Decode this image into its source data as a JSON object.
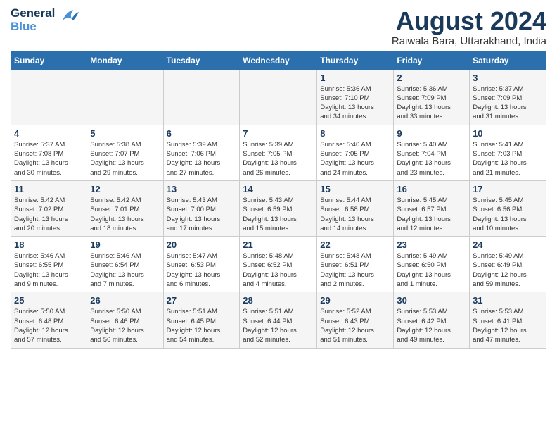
{
  "header": {
    "logo_line1": "General",
    "logo_line2": "Blue",
    "month_title": "August 2024",
    "location": "Raiwala Bara, Uttarakhand, India"
  },
  "days_of_week": [
    "Sunday",
    "Monday",
    "Tuesday",
    "Wednesday",
    "Thursday",
    "Friday",
    "Saturday"
  ],
  "weeks": [
    [
      {
        "day": "",
        "info": ""
      },
      {
        "day": "",
        "info": ""
      },
      {
        "day": "",
        "info": ""
      },
      {
        "day": "",
        "info": ""
      },
      {
        "day": "1",
        "info": "Sunrise: 5:36 AM\nSunset: 7:10 PM\nDaylight: 13 hours\nand 34 minutes."
      },
      {
        "day": "2",
        "info": "Sunrise: 5:36 AM\nSunset: 7:09 PM\nDaylight: 13 hours\nand 33 minutes."
      },
      {
        "day": "3",
        "info": "Sunrise: 5:37 AM\nSunset: 7:09 PM\nDaylight: 13 hours\nand 31 minutes."
      }
    ],
    [
      {
        "day": "4",
        "info": "Sunrise: 5:37 AM\nSunset: 7:08 PM\nDaylight: 13 hours\nand 30 minutes."
      },
      {
        "day": "5",
        "info": "Sunrise: 5:38 AM\nSunset: 7:07 PM\nDaylight: 13 hours\nand 29 minutes."
      },
      {
        "day": "6",
        "info": "Sunrise: 5:39 AM\nSunset: 7:06 PM\nDaylight: 13 hours\nand 27 minutes."
      },
      {
        "day": "7",
        "info": "Sunrise: 5:39 AM\nSunset: 7:05 PM\nDaylight: 13 hours\nand 26 minutes."
      },
      {
        "day": "8",
        "info": "Sunrise: 5:40 AM\nSunset: 7:05 PM\nDaylight: 13 hours\nand 24 minutes."
      },
      {
        "day": "9",
        "info": "Sunrise: 5:40 AM\nSunset: 7:04 PM\nDaylight: 13 hours\nand 23 minutes."
      },
      {
        "day": "10",
        "info": "Sunrise: 5:41 AM\nSunset: 7:03 PM\nDaylight: 13 hours\nand 21 minutes."
      }
    ],
    [
      {
        "day": "11",
        "info": "Sunrise: 5:42 AM\nSunset: 7:02 PM\nDaylight: 13 hours\nand 20 minutes."
      },
      {
        "day": "12",
        "info": "Sunrise: 5:42 AM\nSunset: 7:01 PM\nDaylight: 13 hours\nand 18 minutes."
      },
      {
        "day": "13",
        "info": "Sunrise: 5:43 AM\nSunset: 7:00 PM\nDaylight: 13 hours\nand 17 minutes."
      },
      {
        "day": "14",
        "info": "Sunrise: 5:43 AM\nSunset: 6:59 PM\nDaylight: 13 hours\nand 15 minutes."
      },
      {
        "day": "15",
        "info": "Sunrise: 5:44 AM\nSunset: 6:58 PM\nDaylight: 13 hours\nand 14 minutes."
      },
      {
        "day": "16",
        "info": "Sunrise: 5:45 AM\nSunset: 6:57 PM\nDaylight: 13 hours\nand 12 minutes."
      },
      {
        "day": "17",
        "info": "Sunrise: 5:45 AM\nSunset: 6:56 PM\nDaylight: 13 hours\nand 10 minutes."
      }
    ],
    [
      {
        "day": "18",
        "info": "Sunrise: 5:46 AM\nSunset: 6:55 PM\nDaylight: 13 hours\nand 9 minutes."
      },
      {
        "day": "19",
        "info": "Sunrise: 5:46 AM\nSunset: 6:54 PM\nDaylight: 13 hours\nand 7 minutes."
      },
      {
        "day": "20",
        "info": "Sunrise: 5:47 AM\nSunset: 6:53 PM\nDaylight: 13 hours\nand 6 minutes."
      },
      {
        "day": "21",
        "info": "Sunrise: 5:48 AM\nSunset: 6:52 PM\nDaylight: 13 hours\nand 4 minutes."
      },
      {
        "day": "22",
        "info": "Sunrise: 5:48 AM\nSunset: 6:51 PM\nDaylight: 13 hours\nand 2 minutes."
      },
      {
        "day": "23",
        "info": "Sunrise: 5:49 AM\nSunset: 6:50 PM\nDaylight: 13 hours\nand 1 minute."
      },
      {
        "day": "24",
        "info": "Sunrise: 5:49 AM\nSunset: 6:49 PM\nDaylight: 12 hours\nand 59 minutes."
      }
    ],
    [
      {
        "day": "25",
        "info": "Sunrise: 5:50 AM\nSunset: 6:48 PM\nDaylight: 12 hours\nand 57 minutes."
      },
      {
        "day": "26",
        "info": "Sunrise: 5:50 AM\nSunset: 6:46 PM\nDaylight: 12 hours\nand 56 minutes."
      },
      {
        "day": "27",
        "info": "Sunrise: 5:51 AM\nSunset: 6:45 PM\nDaylight: 12 hours\nand 54 minutes."
      },
      {
        "day": "28",
        "info": "Sunrise: 5:51 AM\nSunset: 6:44 PM\nDaylight: 12 hours\nand 52 minutes."
      },
      {
        "day": "29",
        "info": "Sunrise: 5:52 AM\nSunset: 6:43 PM\nDaylight: 12 hours\nand 51 minutes."
      },
      {
        "day": "30",
        "info": "Sunrise: 5:53 AM\nSunset: 6:42 PM\nDaylight: 12 hours\nand 49 minutes."
      },
      {
        "day": "31",
        "info": "Sunrise: 5:53 AM\nSunset: 6:41 PM\nDaylight: 12 hours\nand 47 minutes."
      }
    ]
  ]
}
